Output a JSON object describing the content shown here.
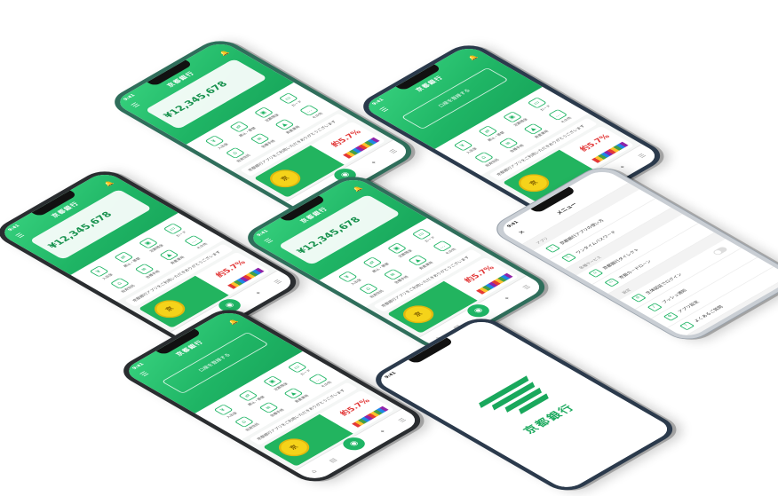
{
  "brand": {
    "bank_name": "京都銀行",
    "logo_color": "#19a85c",
    "accent": "#1fb565"
  },
  "status": {
    "time": "9:41"
  },
  "home": {
    "menu_icon": "hamburger-icon",
    "bell_icon": "bell-icon",
    "balance": "¥12,345,678",
    "login_label": "口座を登録する",
    "grid": [
      {
        "icon": "yen-icon",
        "label": "入出金"
      },
      {
        "icon": "transfer-icon",
        "label": "振込・振替"
      },
      {
        "icon": "wallet-icon",
        "label": "定期預金"
      },
      {
        "icon": "card-icon",
        "label": "カード"
      },
      {
        "icon": "bank-icon",
        "label": "投資信託"
      },
      {
        "icon": "doc-icon",
        "label": "各種手続"
      },
      {
        "icon": "chart-icon",
        "label": "資産運用"
      },
      {
        "icon": "more-icon",
        "label": "その他"
      }
    ],
    "notice": "京都銀行アプリをご利用いただきありがとうございます",
    "banner": {
      "coin": "京",
      "rate": "約5.7%"
    },
    "tabs": [
      "home-icon",
      "bank-icon",
      "qr-icon",
      "gift-icon",
      "menu-icon"
    ]
  },
  "menu_screen": {
    "title": "メニュー",
    "close_icon": "close-icon",
    "sections": [
      {
        "heading": "アプリ",
        "rows": [
          "京都銀行アプリの使い方",
          "ワンタイムパスワード"
        ]
      },
      {
        "heading": "各種サービス",
        "rows": [
          "京都銀行ダイレクト",
          "京銀カードローン"
        ]
      },
      {
        "heading": "設定",
        "rows": [
          "生体認証でログイン",
          "プッシュ通知",
          "アプリ設定",
          "よくあるご質問"
        ]
      }
    ]
  }
}
